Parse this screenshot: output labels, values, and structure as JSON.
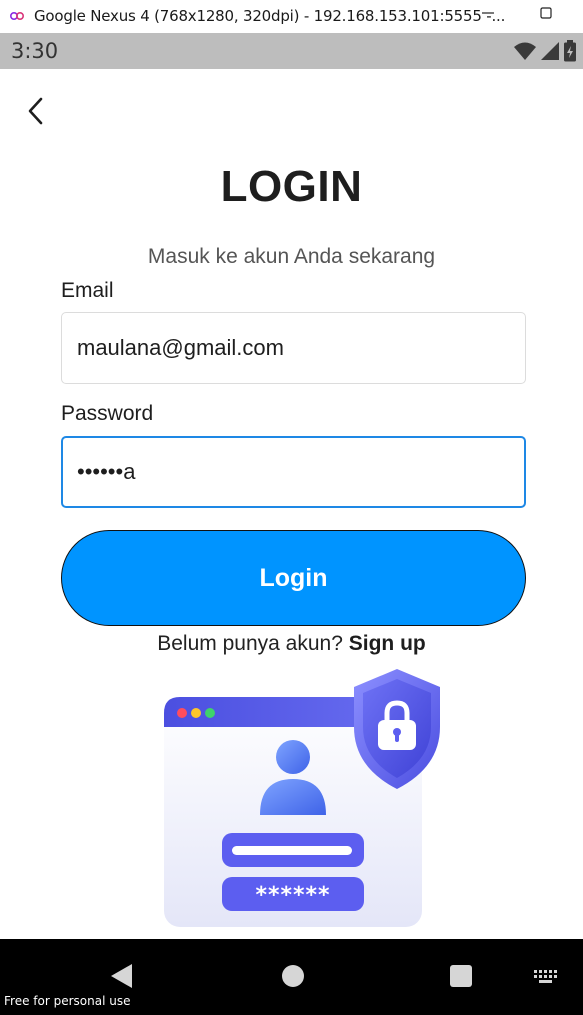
{
  "window": {
    "title": "Google Nexus 4 (768x1280, 320dpi) - 192.168.153.101:5555 -...",
    "logo_icon": "emulator-logo-icon",
    "minimize_icon": "minimize-icon",
    "maximize_icon": "maximize-icon"
  },
  "status_bar": {
    "time": "3:30",
    "icons": [
      "wifi-icon",
      "signal-icon",
      "battery-icon"
    ]
  },
  "app": {
    "back_icon": "chevron-left-icon",
    "title": "LOGIN",
    "subtitle": "Masuk ke akun Anda sekarang",
    "email_label": "Email",
    "email_value": "maulana@gmail.com",
    "password_label": "Password",
    "password_value": "••••••a",
    "login_label": "Login",
    "signup_prompt": "Belum punya akun?",
    "signup_link": "Sign up",
    "illustration": {
      "icons": [
        "browser-window-icon",
        "user-avatar-icon",
        "shield-lock-icon"
      ],
      "password_mask": "******"
    },
    "colors": {
      "primary": "#0094ff",
      "input_focus_border": "#1e88e5",
      "illustration_accent": "#5c5ef0"
    }
  },
  "nav_bar": {
    "icons": [
      "back-triangle-icon",
      "home-circle-icon",
      "recents-square-icon",
      "keyboard-icon"
    ],
    "watermark": "Free for personal use"
  }
}
